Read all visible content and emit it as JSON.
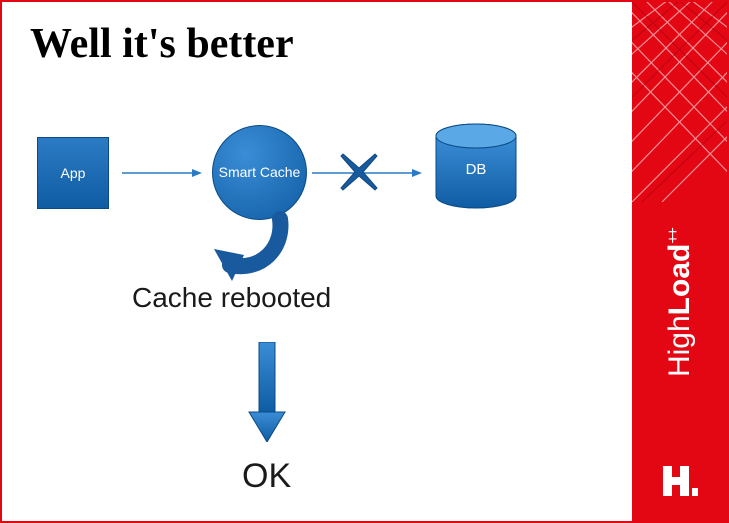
{
  "title": "Well it's better",
  "nodes": {
    "app": "App",
    "cache": "Smart Cache",
    "db": "DB"
  },
  "labels": {
    "rebooted": "Cache rebooted",
    "ok": "OK"
  },
  "brand": {
    "text1": "High",
    "text2": "Load",
    "plus": "++"
  },
  "colors": {
    "accent": "#e30613",
    "node_fill": "#1b6fb8",
    "node_dark": "#0f5ca3"
  }
}
